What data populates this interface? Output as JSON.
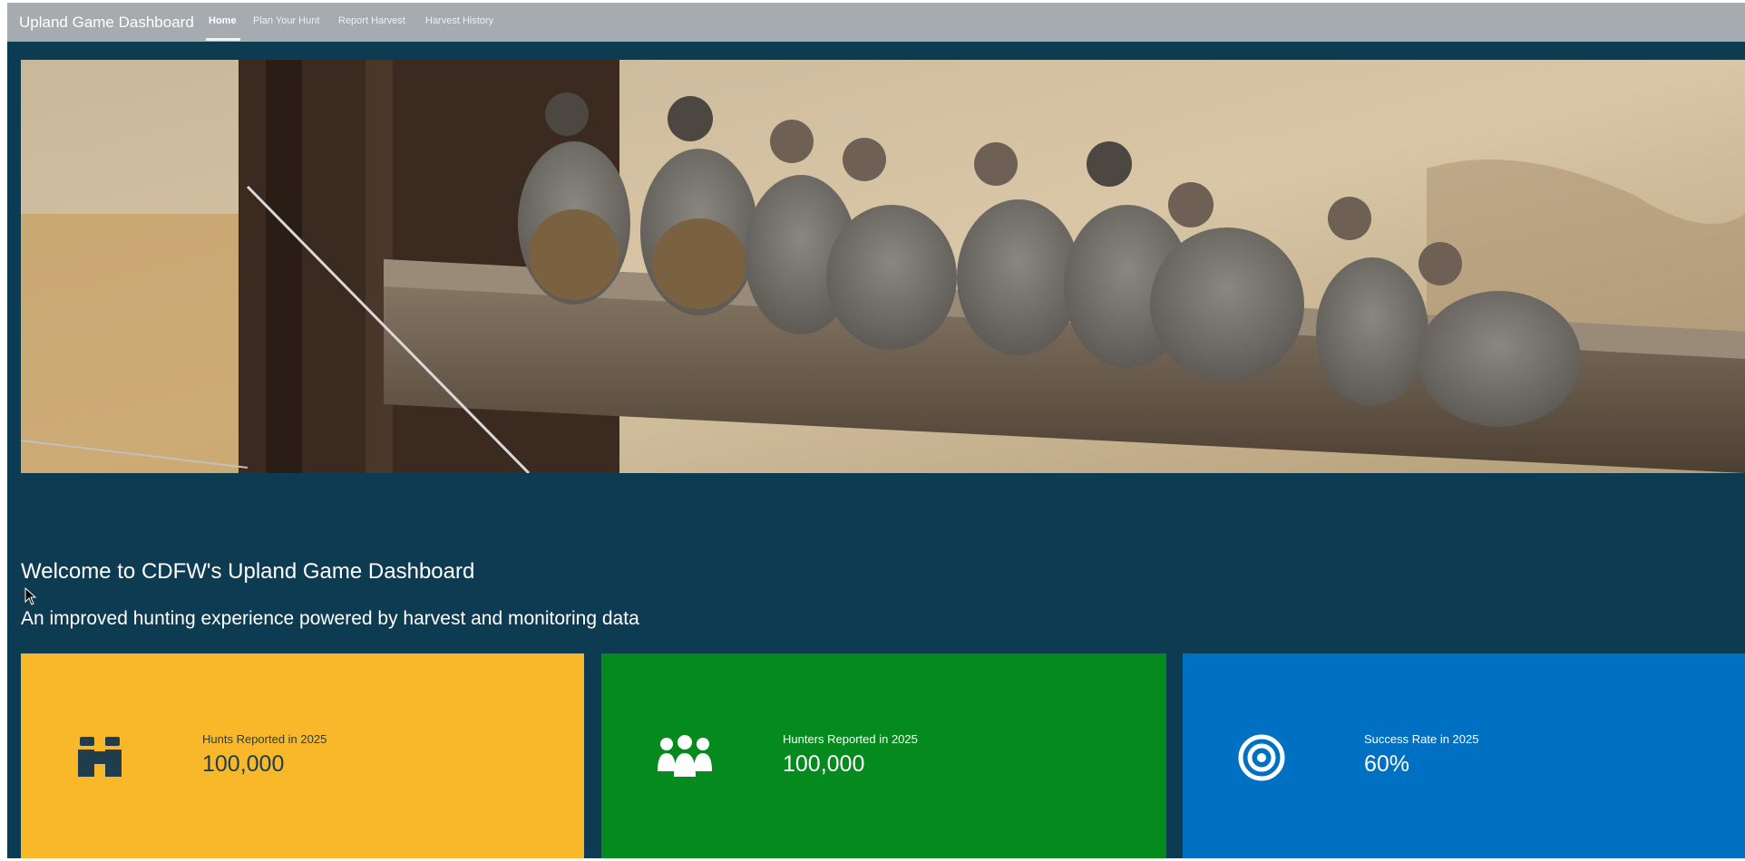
{
  "navbar": {
    "brand": "Upland Game Dashboard",
    "items": [
      {
        "label": "Home",
        "active": true
      },
      {
        "label": "Plan Your Hunt",
        "active": false
      },
      {
        "label": "Report Harvest",
        "active": false
      },
      {
        "label": "Harvest History",
        "active": false
      }
    ]
  },
  "main": {
    "title": "Welcome to CDFW's Upland Game Dashboard",
    "subtitle": "An improved hunting experience powered by harvest and monitoring data"
  },
  "cards": [
    {
      "label": "Hunts Reported in 2025",
      "value": "100,000",
      "icon": "binoculars-icon",
      "color": "#f8b829",
      "text_color": "#1f3d4d"
    },
    {
      "label": "Hunters Reported in 2025",
      "value": "100,000",
      "icon": "users-icon",
      "color": "#058a1e",
      "text_color": "#ffffff"
    },
    {
      "label": "Success Rate in 2025",
      "value": "60%",
      "icon": "target-icon",
      "color": "#0070c2",
      "text_color": "#ffffff"
    }
  ],
  "colors": {
    "page_bg": "#0d3b52",
    "navbar_bg": "#a6abb0"
  }
}
